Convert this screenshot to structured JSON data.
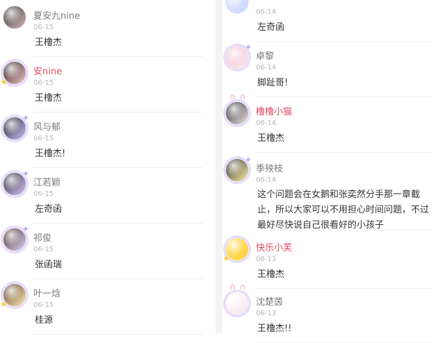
{
  "left": {
    "items": [
      {
        "username": "夏安九nine",
        "date": "06-15",
        "reply": "王橹杰",
        "username_color": "gray",
        "avatar_colors": [
          "#3a3a3a",
          "#d0b3b3"
        ]
      },
      {
        "username": "安nine",
        "date": "06-15",
        "reply": "王橹杰",
        "username_color": "red",
        "avatar_colors": [
          "#2b1b1b",
          "#f2c9c9"
        ]
      },
      {
        "username": "风与郁",
        "date": "06-15",
        "reply": "王橹杰!",
        "username_color": "gray",
        "avatar_colors": [
          "#1a1a1a",
          "#cfc6ff"
        ]
      },
      {
        "username": "江若颖",
        "date": "06-15",
        "reply": "左奇函",
        "username_color": "gray",
        "avatar_colors": [
          "#282828",
          "#d8c6ff"
        ]
      },
      {
        "username": "祁俊",
        "date": "06-15",
        "reply": "张函瑞",
        "username_color": "gray",
        "avatar_colors": [
          "#3d2a20",
          "#e7d6ff"
        ]
      },
      {
        "username": "叶一焓",
        "date": "06-15",
        "reply": "桂源",
        "username_color": "gray",
        "avatar_colors": [
          "#5a3f2a",
          "#ffe9b5"
        ]
      }
    ]
  },
  "right": {
    "items": [
      {
        "username": "",
        "date": "06-14",
        "reply": "左奇函",
        "username_color": "gray",
        "avatar_colors": [
          "#e0e8ff",
          "#cfd7ff"
        ]
      },
      {
        "username": "卓黎",
        "date": "06-14",
        "reply": "脚趾哥!",
        "username_color": "gray",
        "avatar_colors": [
          "#f3c7d4",
          "#fbe7ee"
        ]
      },
      {
        "username": "橹橹小猫",
        "date": "06-14",
        "reply": "王橹杰",
        "username_color": "red",
        "avatar_colors": [
          "#2a2a2a",
          "#f1e7e7"
        ]
      },
      {
        "username": "季殃枝",
        "date": "06-14",
        "reply": "这个问题会在女鹅和张奕然分手那一章截止，所以大家可以不用担心时间问题，不过最好尽快说自己很看好的小孩子",
        "username_color": "gray",
        "avatar_colors": [
          "#2a2a2a",
          "#fff2a8"
        ]
      },
      {
        "username": "快乐小芙",
        "date": "06-13",
        "reply": "王橹杰",
        "username_color": "red",
        "avatar_colors": [
          "#ffe06b",
          "#ffd23f"
        ]
      },
      {
        "username": "沈楚茵",
        "date": "06-13",
        "reply": "王橹杰!!",
        "username_color": "gray",
        "avatar_colors": [
          "#ffffff",
          "#f5e6ea"
        ]
      }
    ]
  },
  "colors": {
    "red": "#e04b63",
    "gray": "#7a7a7a",
    "date": "#b6b6b6",
    "text": "#333333"
  },
  "icons": [
    "avatar-frame-icon",
    "sparkle-icon",
    "bunny-ears-icon",
    "star-icon"
  ]
}
